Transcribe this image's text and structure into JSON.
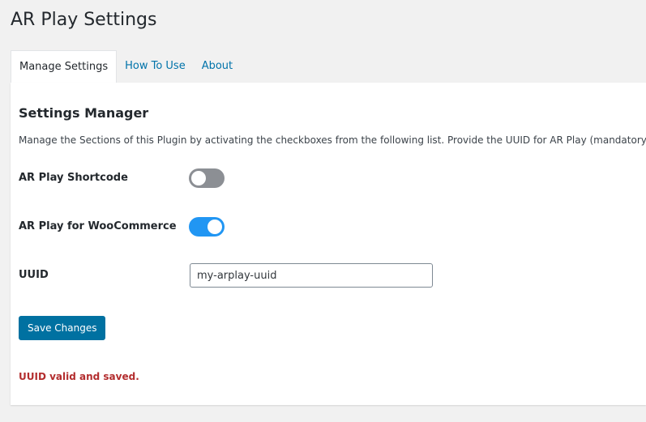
{
  "page": {
    "title": "AR Play Settings"
  },
  "tabs": [
    {
      "label": "Manage Settings",
      "active": true
    },
    {
      "label": "How To Use",
      "active": false
    },
    {
      "label": "About",
      "active": false
    }
  ],
  "settings": {
    "section_title": "Settings Manager",
    "description": "Manage the Sections of this Plugin by activating the checkboxes from the following list. Provide the UUID for AR Play (mandatory).",
    "shortcode": {
      "label": "AR Play Shortcode",
      "enabled": false
    },
    "woocommerce": {
      "label": "AR Play for WooCommerce",
      "enabled": true
    },
    "uuid": {
      "label": "UUID",
      "value": "my-arplay-uuid"
    },
    "save_label": "Save Changes",
    "status_message": "UUID valid and saved."
  },
  "colors": {
    "toggle_on": "#2196f3",
    "toggle_off": "#8c8f94",
    "primary_button": "#0071a1",
    "status_error": "#b32d2e",
    "link": "#0073aa"
  }
}
